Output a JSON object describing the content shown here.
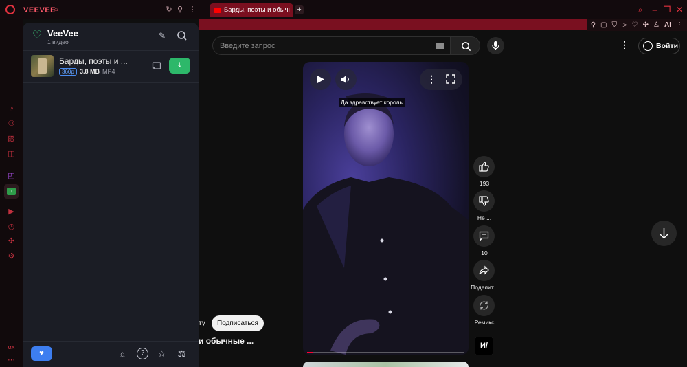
{
  "browser": {
    "brand": "VEEVEE",
    "tab_title": "Барды, поэты и обычные",
    "ai_label": "AI"
  },
  "sidebar_bottom_label": "αx",
  "veevee": {
    "title": "VeeVee",
    "subtitle": "1 видео",
    "item": {
      "title": "Барды, поэты и ...",
      "quality": "360p",
      "size": "3.8 MB",
      "format": "MP4"
    }
  },
  "youtube": {
    "search_placeholder": "Введите запрос",
    "login_label": "Войти",
    "caption": "Да здравствует король",
    "progress": 0.04,
    "actions": {
      "likes": "193",
      "dislike": "Не ...",
      "comments": "10",
      "share": "Поделит...",
      "remix": "Ремикс"
    },
    "channel_fragment": "ту",
    "subscribe_label": "Подписаться",
    "title_fragment": "и обычные ...",
    "shorts_logo": "И/"
  },
  "colors": {
    "accent": "#e3323f",
    "tab_bg": "#7a0f1f",
    "download": "#2db86a",
    "heart": "#3d7ef0"
  },
  "icons": [
    "opera-logo-icon",
    "lock-icon",
    "reload-icon",
    "pin-icon",
    "more-icon",
    "youtube-icon",
    "plus-icon",
    "search-icon",
    "minimize-icon",
    "maximize-icon",
    "close-icon",
    "brush-icon",
    "cast-icon",
    "download-icon",
    "heart-icon",
    "sun-icon",
    "help-icon",
    "star-icon",
    "scale-icon",
    "play-icon",
    "volume-icon",
    "fullscreen-icon",
    "like-icon",
    "dislike-icon",
    "comment-icon",
    "share-icon",
    "remix-icon",
    "arrow-down-icon",
    "mic-icon",
    "user-icon",
    "keyboard-icon"
  ]
}
